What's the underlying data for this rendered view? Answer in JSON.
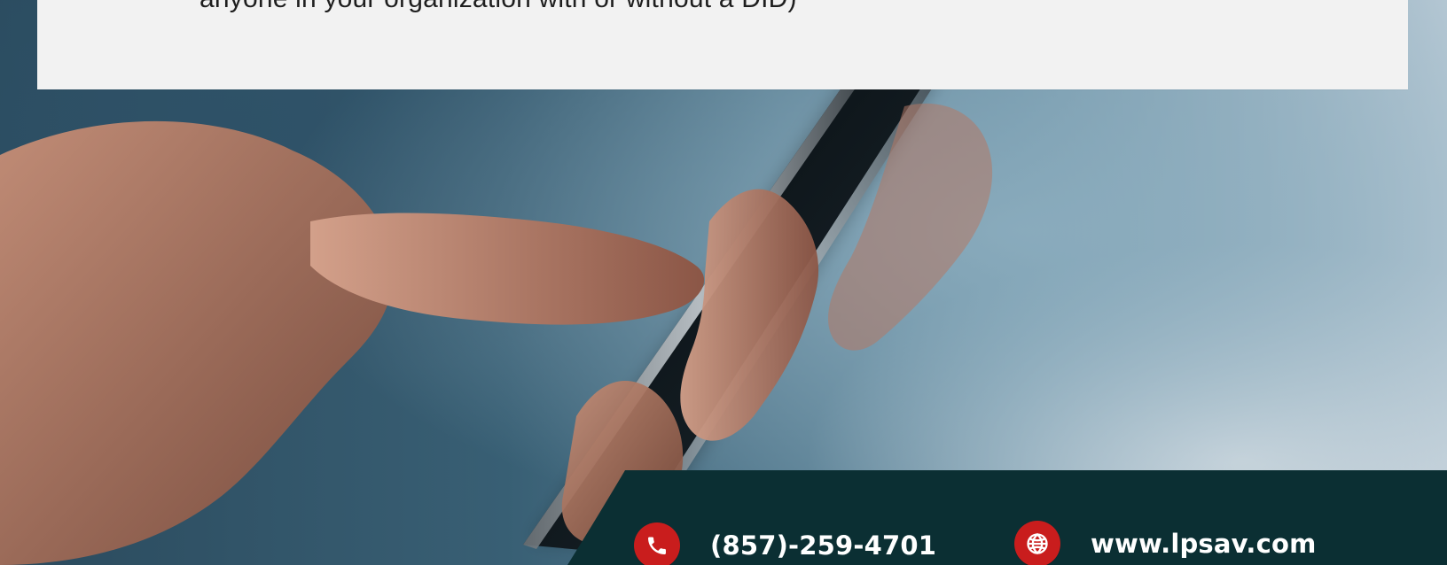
{
  "top_card": {
    "text": "anyone in your organization with or without a DID)"
  },
  "contact": {
    "phone": "(857)-259-4701",
    "website": "www.lpsav.com"
  },
  "icons": {
    "phone": "phone-icon",
    "globe": "globe-icon"
  },
  "colors": {
    "card_bg": "#f2f2f2",
    "text_dark": "#1f1f1f",
    "contact_bar": "#0b2f33",
    "accent_red": "#c91d1d",
    "white": "#ffffff"
  }
}
